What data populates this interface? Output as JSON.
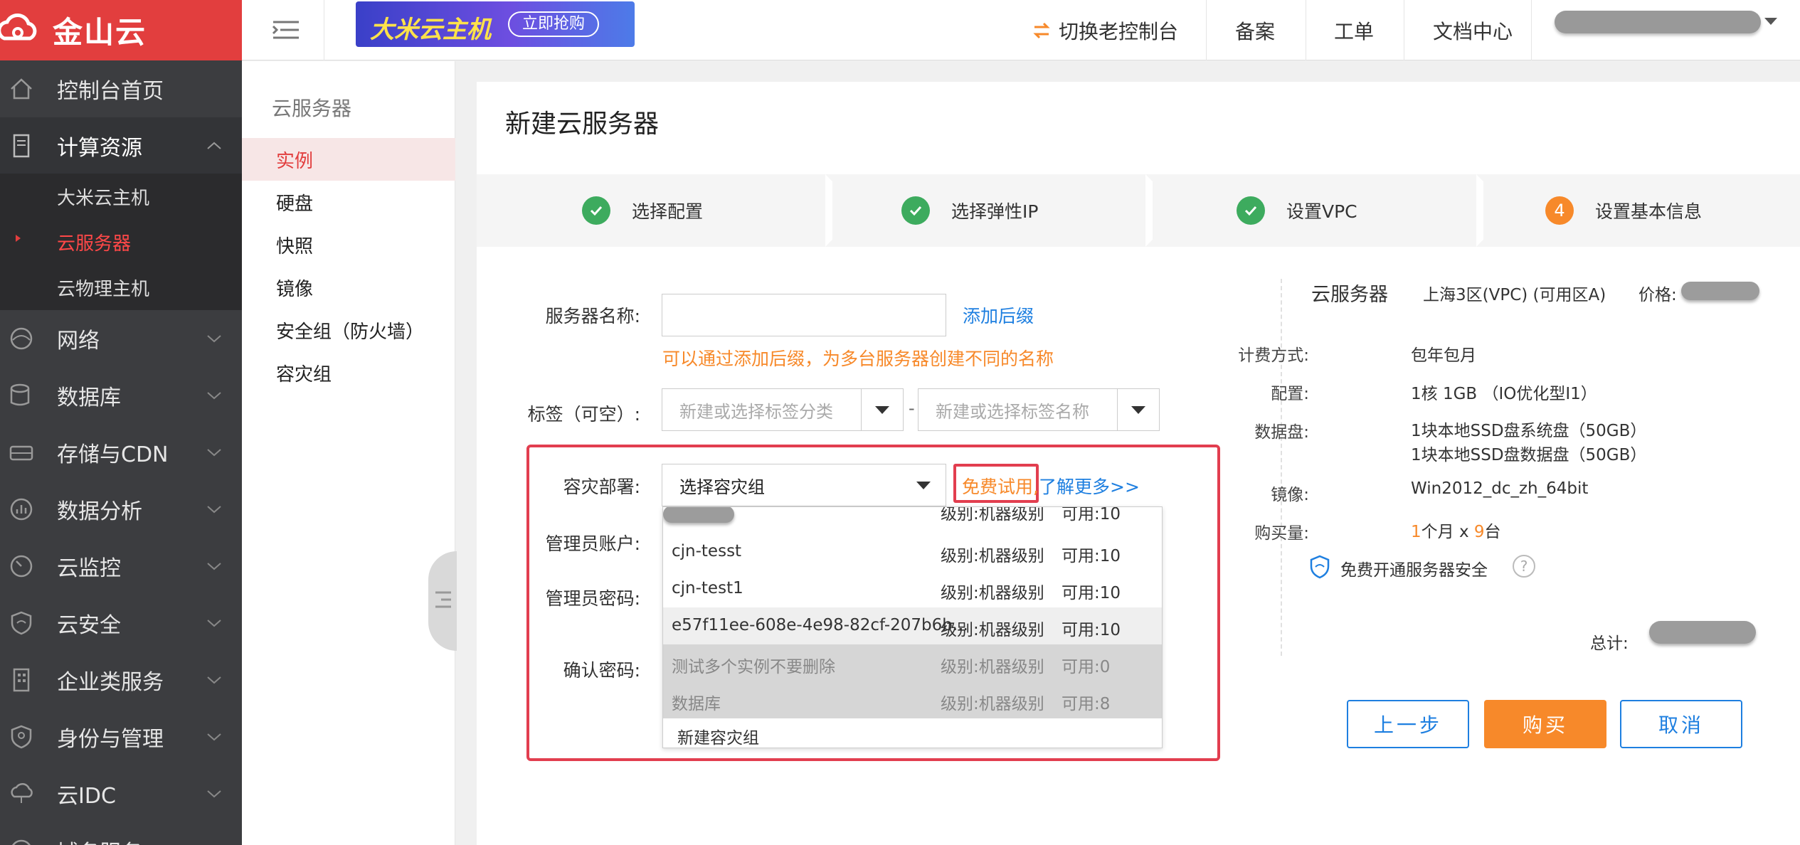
{
  "brand": "金山云",
  "left_nav": {
    "items": [
      {
        "label": "控制台首页",
        "icon": "home-icon"
      },
      {
        "label": "计算资源",
        "icon": "server-icon"
      },
      {
        "label": "网络",
        "icon": "network-icon"
      },
      {
        "label": "数据库",
        "icon": "database-icon"
      },
      {
        "label": "存储与CDN",
        "icon": "storage-icon"
      },
      {
        "label": "数据分析",
        "icon": "analytics-icon"
      },
      {
        "label": "云监控",
        "icon": "monitor-icon"
      },
      {
        "label": "云安全",
        "icon": "shield-icon"
      },
      {
        "label": "企业类服务",
        "icon": "building-icon"
      },
      {
        "label": "身份与管理",
        "icon": "identity-icon"
      },
      {
        "label": "云IDC",
        "icon": "idc-icon"
      },
      {
        "label": "域名服务",
        "icon": "domain-icon"
      }
    ],
    "sub_items": [
      "大米云主机",
      "云服务器",
      "云物理主机"
    ]
  },
  "header": {
    "banner_text": "大米云主机",
    "banner_button": "立即抢购",
    "links": [
      "切换老控制台",
      "备案",
      "工单",
      "文档中心"
    ]
  },
  "sec_menu": {
    "title": "云服务器",
    "items": [
      "实例",
      "硬盘",
      "快照",
      "镜像",
      "安全组（防火墙）",
      "容灾组"
    ]
  },
  "page": {
    "title": "新建云服务器",
    "steps": [
      {
        "label": "选择配置",
        "status": "done"
      },
      {
        "label": "选择弹性IP",
        "status": "done"
      },
      {
        "label": "设置VPC",
        "status": "done"
      },
      {
        "label": "设置基本信息",
        "status": "current",
        "number": "4"
      }
    ]
  },
  "form": {
    "server_name_label": "服务器名称:",
    "add_suffix": "添加后缀",
    "suffix_hint": "可以通过添加后缀，为多台服务器创建不同的名称",
    "tag_label": "标签（可空）:",
    "tag_category_placeholder": "新建或选择标签分类",
    "tag_sep": "-",
    "tag_name_placeholder": "新建或选择标签名称",
    "dr_label": "容灾部署:",
    "dr_select": "选择容灾组",
    "free_trial": "免费试用,",
    "learn_more": "了解更多>>",
    "admin_account_label": "管理员账户:",
    "admin_password_label": "管理员密码:",
    "confirm_password_label": "确认密码:"
  },
  "dr_dropdown": {
    "partial_top": {
      "level": "级别:机器级别",
      "avail": "可用:10"
    },
    "rows": [
      {
        "name": "cjn-tesst",
        "level": "级别:机器级别",
        "avail": "可用:10",
        "state": "normal"
      },
      {
        "name": "cjn-test1",
        "level": "级别:机器级别",
        "avail": "可用:10",
        "state": "normal"
      },
      {
        "name": "e57f11ee-608e-4e98-82cf-207b6b...",
        "level": "级别:机器级别",
        "avail": "可用:10",
        "state": "hover"
      },
      {
        "name": "测试多个实例不要删除",
        "level": "级别:机器级别",
        "avail": "可用:0",
        "state": "disabled"
      },
      {
        "name": "数据库",
        "level": "级别:机器级别",
        "avail": "可用:8",
        "state": "disabled"
      }
    ],
    "create_new": "新建容灾组"
  },
  "summary": {
    "title": "云服务器",
    "region": "上海3区(VPC) (可用区A)",
    "price_label": "价格:",
    "billing_label": "计费方式:",
    "billing_value": "包年包月",
    "config_label": "配置:",
    "config_value": "1核 1GB （IO优化型I1）",
    "disk_label": "数据盘:",
    "disk_value_1": "1块本地SSD盘系统盘（50GB）",
    "disk_value_2": "1块本地SSD盘数据盘（50GB）",
    "image_label": "镜像:",
    "image_value": "Win2012_dc_zh_64bit",
    "qty_label": "购买量:",
    "qty_months": "1",
    "qty_mid": "个月 x ",
    "qty_count": "9",
    "qty_unit": "台",
    "security_text": "免费开通服务器安全",
    "help": "?",
    "total_label": "总计:"
  },
  "buttons": {
    "prev": "上一步",
    "buy": "购买",
    "cancel": "取消"
  },
  "colors": {
    "brand_red": "#e23e3e",
    "accent_orange": "#f7892a",
    "link_blue": "#1e7fe0",
    "success_green": "#3dab5e",
    "highlight_red": "#e23e4f"
  }
}
